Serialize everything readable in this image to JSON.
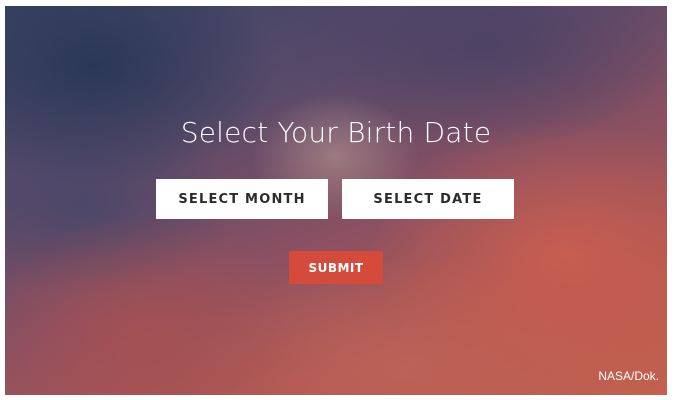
{
  "form": {
    "title": "Select Your Birth Date",
    "month_select_label": "SELECT MONTH",
    "date_select_label": "SELECT DATE",
    "submit_label": "SUBMIT"
  },
  "credit": "NASA/Dok.",
  "colors": {
    "submit_background": "#d44a3b",
    "select_background": "#ffffff",
    "text_light": "#ffffff",
    "text_dark": "#2b2b2b"
  }
}
